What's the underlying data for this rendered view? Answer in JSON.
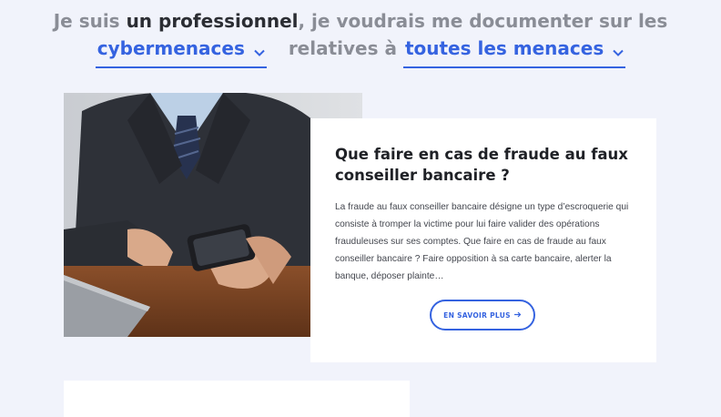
{
  "headline": {
    "line1_pre": "Je suis",
    "line1_strong": "un professionnel",
    "line1_post": ", je voudrais me documenter sur les",
    "select_topic": "cybermenaces",
    "middle": "relatives à",
    "select_scope": "toutes les menaces"
  },
  "article": {
    "title": "Que faire en cas de fraude au faux conseiller bancaire ?",
    "excerpt": "La fraude au faux conseiller bancaire désigne un type d’escroquerie qui consiste à tromper la victime pour lui faire valider des opérations frauduleuses sur ses comptes. Que faire en cas de fraude au faux conseiller bancaire ? Faire opposition à sa carte bancaire, alerter la banque, déposer plainte…",
    "button_label": "EN SAVOIR PLUS",
    "button_icon": "arrow-right-icon"
  },
  "colors": {
    "accent": "#3563e0",
    "background": "#f1f3fb",
    "muted_text": "#8a8d96",
    "dark_text": "#2b2d33"
  }
}
